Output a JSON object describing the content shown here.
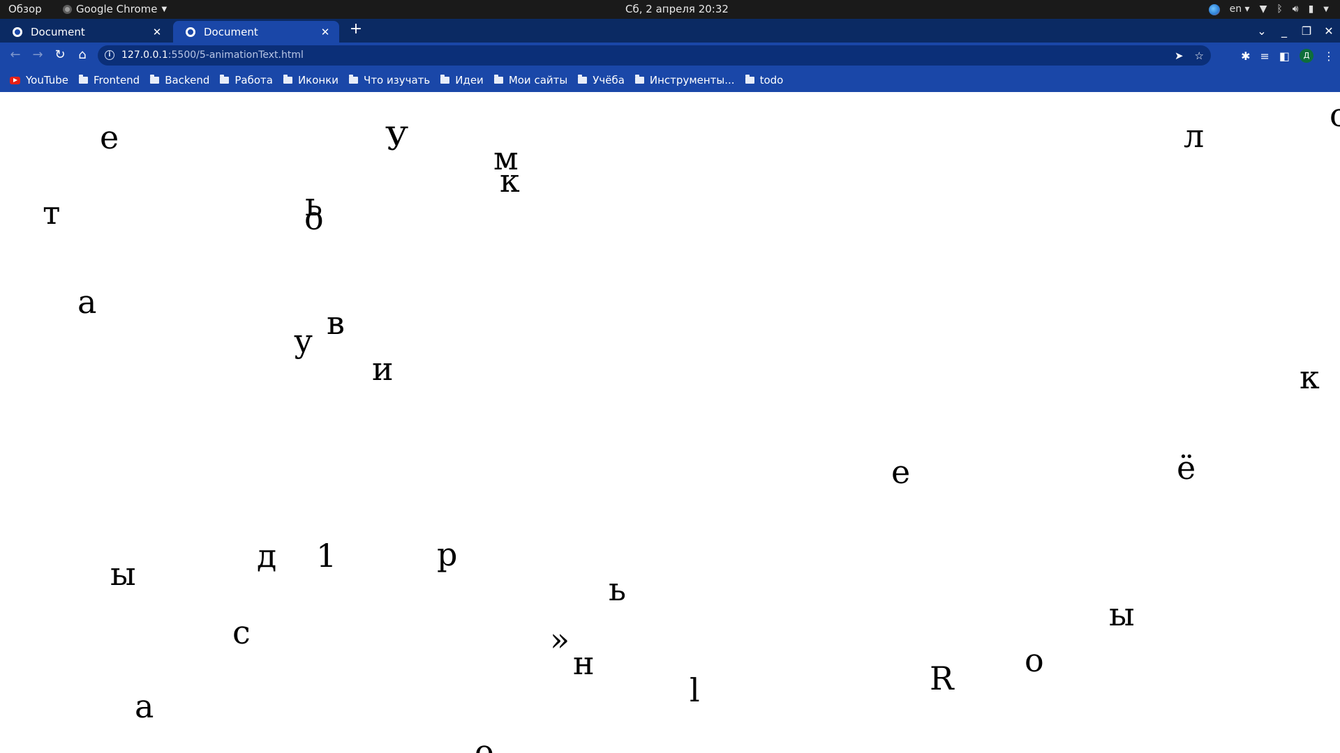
{
  "topbar": {
    "activities": "Обзор",
    "app_name": "Google Chrome",
    "datetime": "Сб, 2 апреля  20:32",
    "language": "en"
  },
  "tabs": [
    {
      "title": "Document",
      "active": false
    },
    {
      "title": "Document",
      "active": true
    }
  ],
  "address_bar": {
    "url_host": "127.0.0.1",
    "url_path": ":5500/5-animationText.html"
  },
  "profile_initial": "Д",
  "bookmarks": [
    {
      "label": "YouTube",
      "icon": "youtube-icon"
    },
    {
      "label": "Frontend",
      "icon": "folder-icon"
    },
    {
      "label": "Backend",
      "icon": "folder-icon"
    },
    {
      "label": "Работа",
      "icon": "folder-icon"
    },
    {
      "label": "Иконки",
      "icon": "folder-icon"
    },
    {
      "label": "Что изучать",
      "icon": "folder-icon"
    },
    {
      "label": "Идеи",
      "icon": "folder-icon"
    },
    {
      "label": "Мои сайты",
      "icon": "folder-icon"
    },
    {
      "label": "Учёба",
      "icon": "folder-icon"
    },
    {
      "label": "Инструменты...",
      "icon": "folder-icon"
    },
    {
      "label": "todo",
      "icon": "folder-icon"
    }
  ],
  "letters": [
    "е",
    "У",
    "м",
    "к",
    "л",
    "с",
    "т",
    "ь",
    "о",
    "а",
    "в",
    "у",
    "и",
    "к",
    "е",
    "ё",
    "д",
    "1",
    "р",
    "ы",
    "ь",
    "ы",
    "с",
    "»",
    "н",
    "о",
    "R",
    "а",
    "l",
    "о"
  ]
}
